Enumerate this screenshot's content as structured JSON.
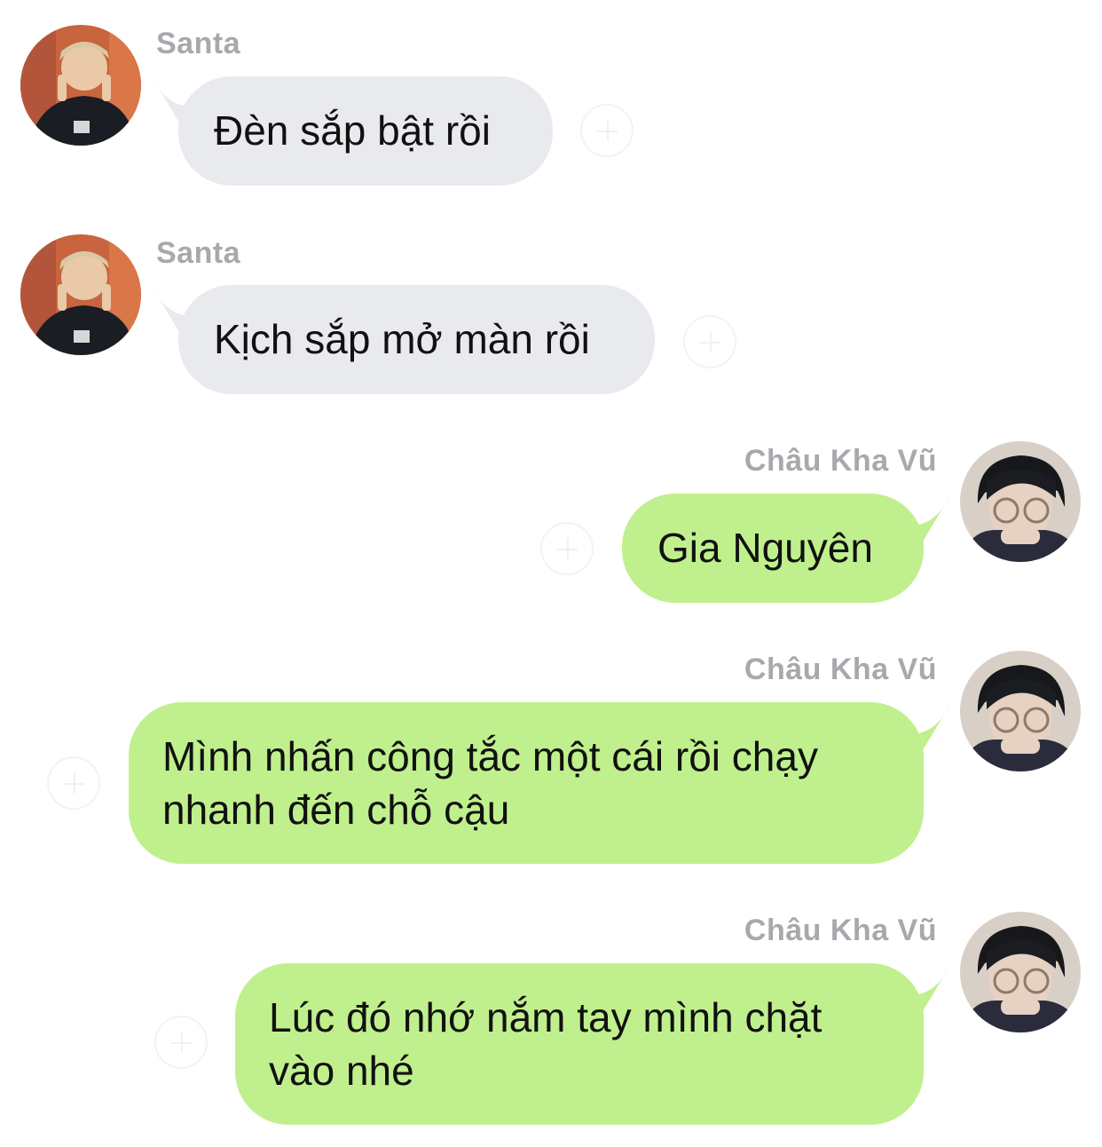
{
  "colors": {
    "incoming_bubble": "#e8eaee",
    "outgoing_bubble": "#c0f08d",
    "sender_name": "#a7a9ad",
    "message_text": "#111111"
  },
  "messages": [
    {
      "direction": "incoming",
      "sender": "Santa",
      "avatar": "santa-avatar",
      "lines": [
        "Đèn sắp bật rồi"
      ]
    },
    {
      "direction": "incoming",
      "sender": "Santa",
      "avatar": "santa-avatar",
      "lines": [
        "Kịch sắp mở màn rồi"
      ]
    },
    {
      "direction": "outgoing",
      "sender": "Châu Kha Vũ",
      "avatar": "chau-kha-vu-avatar",
      "lines": [
        "Gia Nguyên"
      ]
    },
    {
      "direction": "outgoing",
      "sender": "Châu Kha Vũ",
      "avatar": "chau-kha-vu-avatar",
      "lines": [
        "Mình nhấn công tắc một cái rồi chạy",
        "nhanh đến chỗ cậu"
      ]
    },
    {
      "direction": "outgoing",
      "sender": "Châu Kha Vũ",
      "avatar": "chau-kha-vu-avatar",
      "lines": [
        "Lúc đó nhớ nắm tay mình chặt",
        "vào nhé"
      ]
    }
  ],
  "icons": {
    "reaction": "add-reaction-icon"
  }
}
